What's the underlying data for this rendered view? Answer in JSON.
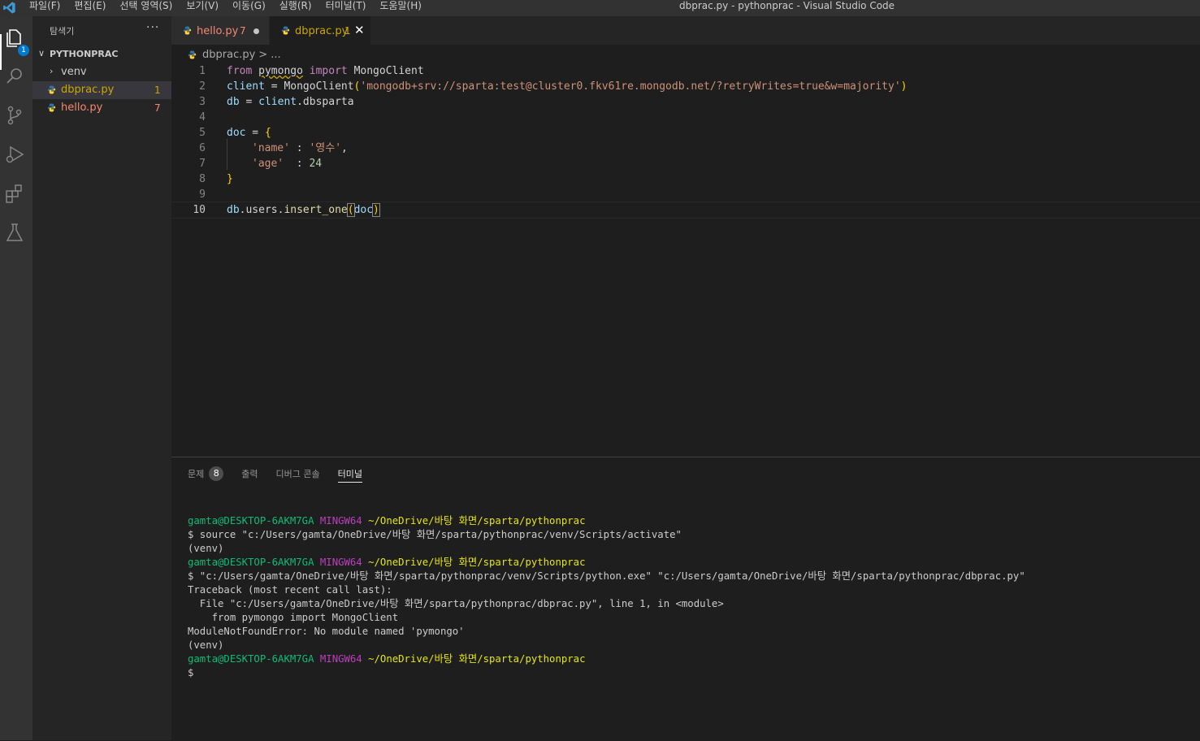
{
  "menu": [
    "파일(F)",
    "편집(E)",
    "선택 영역(S)",
    "보기(V)",
    "이동(G)",
    "실행(R)",
    "터미널(T)",
    "도움말(H)"
  ],
  "window_title": "dbprac.py - pythonprac - Visual Studio Code",
  "activity": {
    "explorer_badge": "1"
  },
  "sidebar": {
    "title": "탐색기",
    "more": "···",
    "folder": "PYTHONPRAC",
    "items": [
      {
        "label": "venv",
        "count": ""
      },
      {
        "label": "dbprac.py",
        "count": "1"
      },
      {
        "label": "hello.py",
        "count": "7"
      }
    ]
  },
  "tabs": [
    {
      "label": "hello.py",
      "count": "7"
    },
    {
      "label": "dbprac.py",
      "count": "1"
    }
  ],
  "breadcrumb": {
    "file": "dbprac.py",
    "sep": ">",
    "rest": "..."
  },
  "editor": {
    "line_numbers": [
      "1",
      "2",
      "3",
      "4",
      "5",
      "6",
      "7",
      "8",
      "9",
      "10"
    ],
    "l1": {
      "from": "from",
      "module": "pymongo",
      "import": "import",
      "cls": "MongoClient"
    },
    "l2": {
      "var": "client",
      "eq": " = ",
      "fn": "MongoClient",
      "open": "(",
      "str": "'mongodb+srv://sparta:test@cluster0.fkv61re.mongodb.net/?retryWrites=true&w=majority'",
      "close": ")"
    },
    "l3": {
      "var": "db",
      "eq": " = ",
      "obj": "client",
      "attr": ".dbsparta"
    },
    "l5": {
      "var": "doc",
      "eq": " = ",
      "brace": "{"
    },
    "l6": {
      "key": "'name'",
      "colon": " : ",
      "val": "'영수'",
      "comma": ","
    },
    "l7": {
      "key": "'age'",
      "colon": "  : ",
      "val": "24"
    },
    "l8": {
      "brace": "}"
    },
    "l10": {
      "obj": "db",
      "attr": ".users.",
      "fn": "insert_one",
      "open": "(",
      "arg": "doc",
      "close": ")"
    }
  },
  "panel": {
    "tabs": [
      {
        "label": "문제",
        "badge": "8"
      },
      {
        "label": "출력",
        "badge": ""
      },
      {
        "label": "디버그 콘솔",
        "badge": ""
      },
      {
        "label": "터미널",
        "badge": ""
      }
    ]
  },
  "terminal": {
    "user": "gamta@DESKTOP-6AKM7GA",
    "shell": "MINGW64",
    "path": "~/OneDrive/바탕 화면/sparta/pythonprac",
    "lines": [
      "$ source \"c:/Users/gamta/OneDrive/바탕 화면/sparta/pythonprac/venv/Scripts/activate\"",
      "(venv)",
      "$ \"c:/Users/gamta/OneDrive/바탕 화면/sparta/pythonprac/venv/Scripts/python.exe\" \"c:/Users/gamta/OneDrive/바탕 화면/sparta/pythonprac/dbprac.py\"",
      "Traceback (most recent call last):",
      "  File \"c:/Users/gamta/OneDrive/바탕 화면/sparta/pythonprac/dbprac.py\", line 1, in <module>",
      "    from pymongo import MongoClient",
      "ModuleNotFoundError: No module named 'pymongo'",
      "(venv)",
      "$"
    ]
  },
  "colors": {
    "accent": "#007acc",
    "error": "#f48771",
    "warning": "#cca700"
  }
}
